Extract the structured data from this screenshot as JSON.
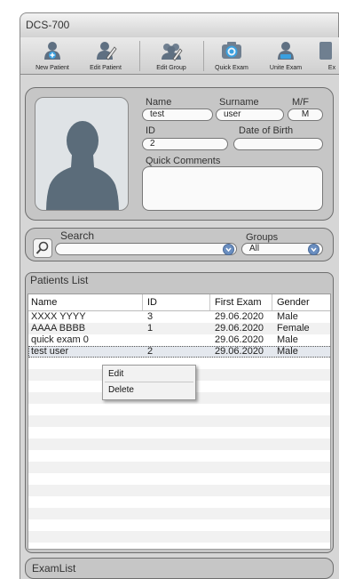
{
  "window": {
    "title": "DCS-700"
  },
  "toolbar": {
    "buttons": [
      {
        "label": "New Patient",
        "icon": "new-patient-icon"
      },
      {
        "label": "Edit Patient",
        "icon": "edit-patient-icon"
      },
      {
        "label": "Edit Group",
        "icon": "edit-group-icon"
      },
      {
        "label": "Quick Exam",
        "icon": "camera-icon"
      },
      {
        "label": "Unite Exam",
        "icon": "unite-exam-icon"
      },
      {
        "label": "Ex",
        "icon": "partial-icon"
      }
    ]
  },
  "patient": {
    "name_label": "Name",
    "name_value": "test",
    "surname_label": "Surname",
    "surname_value": "user",
    "sex_label": "M/F",
    "sex_value": "M",
    "id_label": "ID",
    "id_value": "2",
    "dob_label": "Date of Birth",
    "dob_value": "",
    "comments_label": "Quick Comments",
    "comments_value": ""
  },
  "search": {
    "label": "Search",
    "value": "",
    "groups_label": "Groups",
    "groups_value": "All"
  },
  "patients_list": {
    "title": "Patients List",
    "columns": [
      "Name",
      "ID",
      "First Exam",
      "Gender"
    ],
    "rows": [
      {
        "name": "XXXX YYYY",
        "id": "3",
        "first_exam": "29.06.2020",
        "gender": "Male"
      },
      {
        "name": "AAAA BBBB",
        "id": "1",
        "first_exam": "29.06.2020",
        "gender": "Female"
      },
      {
        "name": "quick exam 0",
        "id": "",
        "first_exam": "29.06.2020",
        "gender": "Male"
      },
      {
        "name": "test user",
        "id": "2",
        "first_exam": "29.06.2020",
        "gender": "Male"
      }
    ]
  },
  "context_menu": {
    "edit": "Edit",
    "delete": "Delete"
  },
  "exam_list": {
    "title": "ExamList"
  }
}
